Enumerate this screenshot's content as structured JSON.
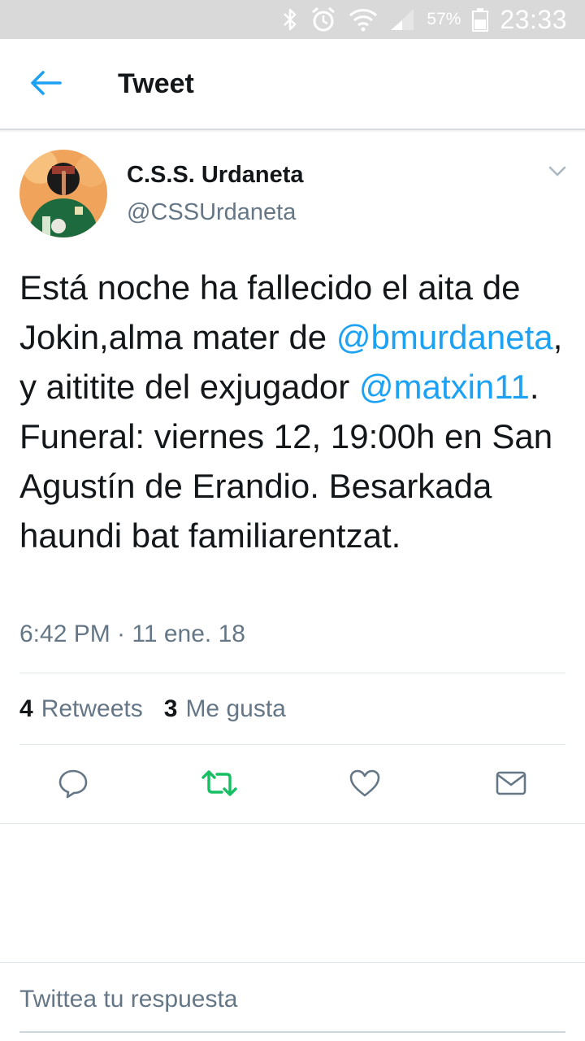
{
  "status_bar": {
    "battery_percent": "57%",
    "time": "23:33",
    "icons": [
      "bluetooth-icon",
      "alarm-icon",
      "wifi-icon",
      "signal-icon",
      "battery-icon"
    ]
  },
  "app_bar": {
    "title": "Tweet",
    "back_icon": "arrow-left-icon"
  },
  "tweet": {
    "author": {
      "display_name": "C.S.S. Urdaneta",
      "handle": "@CSSUrdaneta"
    },
    "text": {
      "p1": "Está noche ha fallecido el aita de Jokin,alma mater de ",
      "mention1": "@bmurdaneta",
      "p2": ", y aititite del exjugador ",
      "mention2": "@matxin11",
      "p3": ". Funeral: viernes 12, 19:00h en San Agustín de Erandio. Besarkada haundi bat familiarentzat."
    },
    "timestamp": "6:42 PM · 11 ene. 18",
    "stats": {
      "retweets_count": "4",
      "retweets_label": "Retweets",
      "likes_count": "3",
      "likes_label": "Me gusta"
    }
  },
  "actions": [
    "reply-icon",
    "retweet-icon",
    "like-icon",
    "message-icon"
  ],
  "reply": {
    "placeholder": "Twittea tu respuesta"
  },
  "colors": {
    "accent": "#1da1f2",
    "retweet_green": "#17bf63",
    "secondary_text": "#657786",
    "primary_text": "#14171a",
    "status_bar": "#d9d9d9"
  }
}
